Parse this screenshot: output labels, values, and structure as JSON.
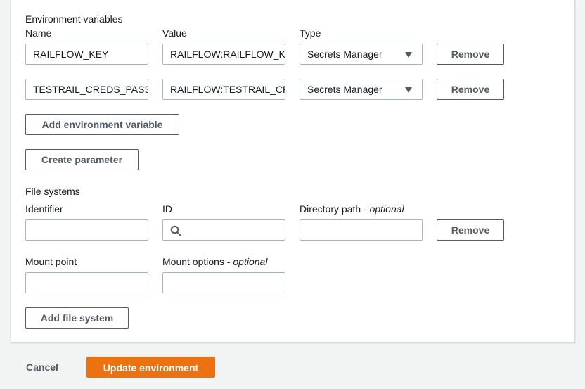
{
  "env": {
    "section_title": "Environment variables",
    "col_name": "Name",
    "col_value": "Value",
    "col_type": "Type",
    "rows": [
      {
        "name": "RAILFLOW_KEY",
        "value": "RAILFLOW:RAILFLOW_K",
        "type": "Secrets Manager",
        "remove": "Remove"
      },
      {
        "name": "TESTRAIL_CREDS_PASS",
        "value": "RAILFLOW:TESTRAIL_CF",
        "type": "Secrets Manager",
        "remove": "Remove"
      }
    ],
    "add_label": "Add environment variable",
    "create_param_label": "Create parameter"
  },
  "fs": {
    "section_title": "File systems",
    "identifier_label": "Identifier",
    "id_label": "ID",
    "directory_label": "Directory path - ",
    "optional": "optional",
    "remove": "Remove",
    "mount_point_label": "Mount point",
    "mount_options_label": "Mount options - ",
    "identifier_value": "",
    "id_value": "",
    "directory_value": "",
    "mount_point_value": "",
    "mount_options_value": "",
    "add_label": "Add file system"
  },
  "footer": {
    "cancel": "Cancel",
    "update": "Update environment"
  },
  "colors": {
    "primary": "#ec7211",
    "border": "#aab7b8",
    "button_text": "#545b64"
  }
}
